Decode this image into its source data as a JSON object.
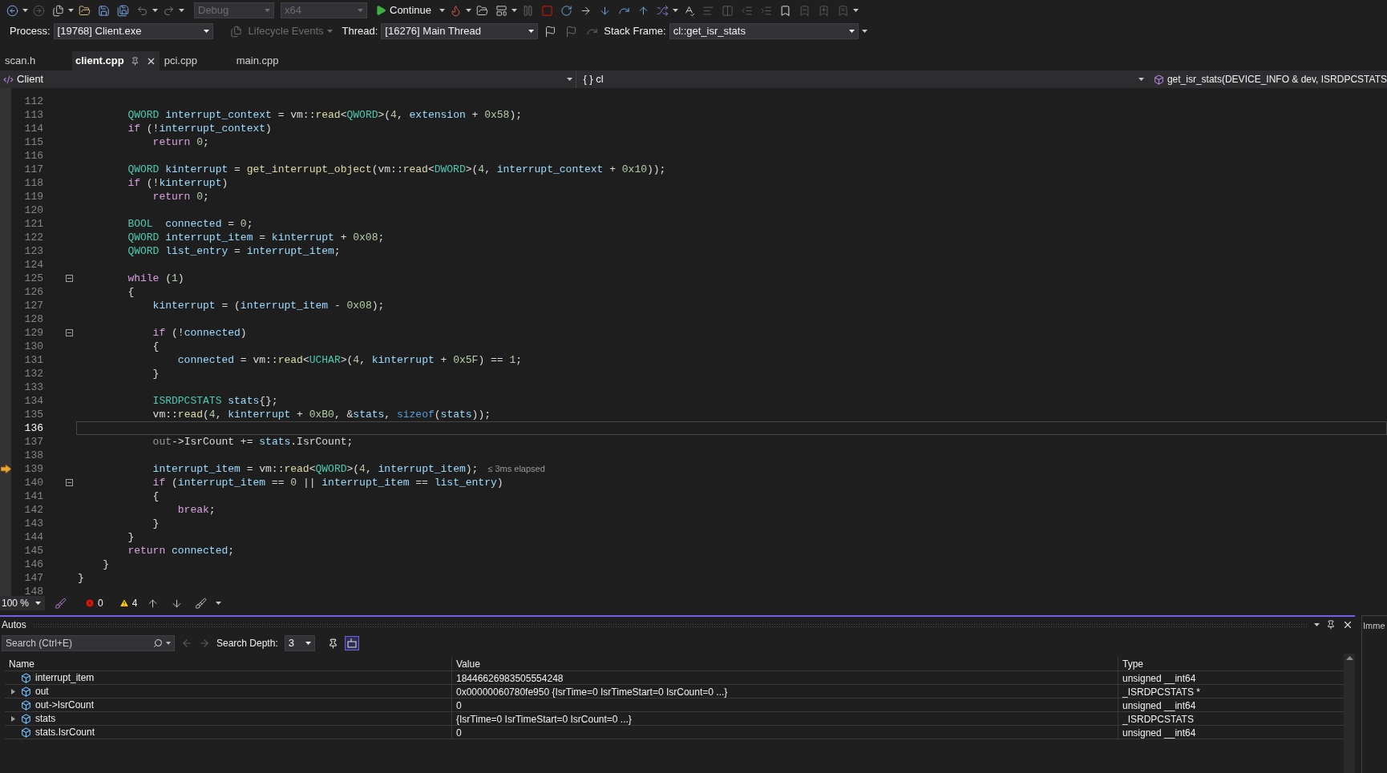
{
  "toolbar": {
    "config": {
      "label": "Debug",
      "disabled": true
    },
    "platform": {
      "label": "x64",
      "disabled": true
    },
    "continue": "Continue",
    "process_label": "Process:",
    "process": "[19768] Client.exe",
    "lifecycle": {
      "label": "Lifecycle Events",
      "disabled": true
    },
    "thread_label": "Thread:",
    "thread": "[16276] Main Thread",
    "stack_label": "Stack Frame:",
    "stack": "cl::get_isr_stats"
  },
  "tabs": [
    {
      "label": "scan.h",
      "selected": false
    },
    {
      "label": "client.cpp",
      "selected": true
    },
    {
      "label": "pci.cpp",
      "selected": false
    },
    {
      "label": "main.cpp",
      "selected": false
    }
  ],
  "navbar": {
    "project": "Client",
    "scope": "{ } cl",
    "member": "get_isr_stats(DEVICE_INFO & dev, ISRDPCSTATS"
  },
  "code": [
    {
      "num": "112",
      "fold": false,
      "current": false,
      "exec": false
    },
    {
      "num": "113",
      "fold": false,
      "current": false,
      "exec": false,
      "tokens": [
        {
          "kind": "type",
          "text": "        QWORD "
        },
        {
          "kind": "var",
          "text": "interrupt_context"
        },
        {
          "kind": "op",
          "text": " = vm::"
        },
        {
          "kind": "fn",
          "text": "read"
        },
        {
          "kind": "op",
          "text": "<"
        },
        {
          "kind": "type",
          "text": "QWORD"
        },
        {
          "kind": "op",
          "text": ">("
        },
        {
          "kind": "num",
          "text": "4"
        },
        {
          "kind": "op",
          "text": ", "
        },
        {
          "kind": "var",
          "text": "extension"
        },
        {
          "kind": "op",
          "text": " + "
        },
        {
          "kind": "num",
          "text": "0x58"
        },
        {
          "kind": "op",
          "text": ");"
        }
      ]
    },
    {
      "num": "114",
      "fold": false,
      "current": false,
      "exec": false,
      "tokens": [
        {
          "kind": "kw",
          "text": "        if"
        },
        {
          "kind": "op",
          "text": " (!"
        },
        {
          "kind": "var",
          "text": "interrupt_context"
        },
        {
          "kind": "op",
          "text": ")"
        }
      ]
    },
    {
      "num": "115",
      "fold": false,
      "current": false,
      "exec": false,
      "tokens": [
        {
          "kind": "kw",
          "text": "            return "
        },
        {
          "kind": "num",
          "text": "0"
        },
        {
          "kind": "op",
          "text": ";"
        }
      ]
    },
    {
      "num": "116",
      "fold": false,
      "current": false,
      "exec": false
    },
    {
      "num": "117",
      "fold": false,
      "current": false,
      "exec": false,
      "tokens": [
        {
          "kind": "type",
          "text": "        QWORD "
        },
        {
          "kind": "var",
          "text": "kinterrupt"
        },
        {
          "kind": "op",
          "text": " = "
        },
        {
          "kind": "fn",
          "text": "get_interrupt_object"
        },
        {
          "kind": "op",
          "text": "(vm::"
        },
        {
          "kind": "fn",
          "text": "read"
        },
        {
          "kind": "op",
          "text": "<"
        },
        {
          "kind": "type",
          "text": "DWORD"
        },
        {
          "kind": "op",
          "text": ">("
        },
        {
          "kind": "num",
          "text": "4"
        },
        {
          "kind": "op",
          "text": ", "
        },
        {
          "kind": "var",
          "text": "interrupt_context"
        },
        {
          "kind": "op",
          "text": " + "
        },
        {
          "kind": "num",
          "text": "0x10"
        },
        {
          "kind": "op",
          "text": "));"
        }
      ]
    },
    {
      "num": "118",
      "fold": false,
      "current": false,
      "exec": false,
      "tokens": [
        {
          "kind": "kw",
          "text": "        if"
        },
        {
          "kind": "op",
          "text": " (!"
        },
        {
          "kind": "var",
          "text": "kinterrupt"
        },
        {
          "kind": "op",
          "text": ")"
        }
      ]
    },
    {
      "num": "119",
      "fold": false,
      "current": false,
      "exec": false,
      "tokens": [
        {
          "kind": "kw",
          "text": "            return "
        },
        {
          "kind": "num",
          "text": "0"
        },
        {
          "kind": "op",
          "text": ";"
        }
      ]
    },
    {
      "num": "120",
      "fold": false,
      "current": false,
      "exec": false
    },
    {
      "num": "121",
      "fold": false,
      "current": false,
      "exec": false,
      "tokens": [
        {
          "kind": "type",
          "text": "        BOOL  "
        },
        {
          "kind": "var",
          "text": "connected"
        },
        {
          "kind": "op",
          "text": " = "
        },
        {
          "kind": "num",
          "text": "0"
        },
        {
          "kind": "op",
          "text": ";"
        }
      ]
    },
    {
      "num": "122",
      "fold": false,
      "current": false,
      "exec": false,
      "tokens": [
        {
          "kind": "type",
          "text": "        QWORD "
        },
        {
          "kind": "var",
          "text": "interrupt_item"
        },
        {
          "kind": "op",
          "text": " = "
        },
        {
          "kind": "var",
          "text": "kinterrupt"
        },
        {
          "kind": "op",
          "text": " + "
        },
        {
          "kind": "num",
          "text": "0x08"
        },
        {
          "kind": "op",
          "text": ";"
        }
      ]
    },
    {
      "num": "123",
      "fold": false,
      "current": false,
      "exec": false,
      "tokens": [
        {
          "kind": "type",
          "text": "        QWORD "
        },
        {
          "kind": "var",
          "text": "list_entry"
        },
        {
          "kind": "op",
          "text": " = "
        },
        {
          "kind": "var",
          "text": "interrupt_item"
        },
        {
          "kind": "op",
          "text": ";"
        }
      ]
    },
    {
      "num": "124",
      "fold": false,
      "current": false,
      "exec": false
    },
    {
      "num": "125",
      "fold": true,
      "current": false,
      "exec": false,
      "tokens": [
        {
          "kind": "kw",
          "text": "        while"
        },
        {
          "kind": "op",
          "text": " ("
        },
        {
          "kind": "num",
          "text": "1"
        },
        {
          "kind": "op",
          "text": ")"
        }
      ]
    },
    {
      "num": "126",
      "fold": false,
      "current": false,
      "exec": false,
      "tokens": [
        {
          "kind": "op",
          "text": "        {"
        }
      ]
    },
    {
      "num": "127",
      "fold": false,
      "current": false,
      "exec": false,
      "tokens": [
        {
          "kind": "var",
          "text": "            kinterrupt"
        },
        {
          "kind": "op",
          "text": " = ("
        },
        {
          "kind": "var",
          "text": "interrupt_item"
        },
        {
          "kind": "op",
          "text": " - "
        },
        {
          "kind": "num",
          "text": "0x08"
        },
        {
          "kind": "op",
          "text": ");"
        }
      ]
    },
    {
      "num": "128",
      "fold": false,
      "current": false,
      "exec": false
    },
    {
      "num": "129",
      "fold": true,
      "current": false,
      "exec": false,
      "tokens": [
        {
          "kind": "kw",
          "text": "            if"
        },
        {
          "kind": "op",
          "text": " (!"
        },
        {
          "kind": "var",
          "text": "connected"
        },
        {
          "kind": "op",
          "text": ")"
        }
      ]
    },
    {
      "num": "130",
      "fold": false,
      "current": false,
      "exec": false,
      "tokens": [
        {
          "kind": "op",
          "text": "            {"
        }
      ]
    },
    {
      "num": "131",
      "fold": false,
      "current": false,
      "exec": false,
      "tokens": [
        {
          "kind": "var",
          "text": "                connected"
        },
        {
          "kind": "op",
          "text": " = vm::"
        },
        {
          "kind": "fn",
          "text": "read"
        },
        {
          "kind": "op",
          "text": "<"
        },
        {
          "kind": "type",
          "text": "UCHAR"
        },
        {
          "kind": "op",
          "text": ">("
        },
        {
          "kind": "num",
          "text": "4"
        },
        {
          "kind": "op",
          "text": ", "
        },
        {
          "kind": "var",
          "text": "kinterrupt"
        },
        {
          "kind": "op",
          "text": " + "
        },
        {
          "kind": "num",
          "text": "0x5F"
        },
        {
          "kind": "op",
          "text": ") == "
        },
        {
          "kind": "num",
          "text": "1"
        },
        {
          "kind": "op",
          "text": ";"
        }
      ]
    },
    {
      "num": "132",
      "fold": false,
      "current": false,
      "exec": false,
      "tokens": [
        {
          "kind": "op",
          "text": "            }"
        }
      ]
    },
    {
      "num": "133",
      "fold": false,
      "current": false,
      "exec": false
    },
    {
      "num": "134",
      "fold": false,
      "current": false,
      "exec": false,
      "tokens": [
        {
          "kind": "type",
          "text": "            ISRDPCSTATS "
        },
        {
          "kind": "var",
          "text": "stats"
        },
        {
          "kind": "op",
          "text": "{};"
        }
      ]
    },
    {
      "num": "135",
      "fold": false,
      "current": false,
      "exec": false,
      "tokens": [
        {
          "kind": "op",
          "text": "            vm::"
        },
        {
          "kind": "fn",
          "text": "read"
        },
        {
          "kind": "op",
          "text": "("
        },
        {
          "kind": "num",
          "text": "4"
        },
        {
          "kind": "op",
          "text": ", "
        },
        {
          "kind": "var",
          "text": "kinterrupt"
        },
        {
          "kind": "op",
          "text": " + "
        },
        {
          "kind": "num",
          "text": "0xB0"
        },
        {
          "kind": "op",
          "text": ", &"
        },
        {
          "kind": "var",
          "text": "stats"
        },
        {
          "kind": "op",
          "text": ", "
        },
        {
          "kind": "kw2",
          "text": "sizeof"
        },
        {
          "kind": "op",
          "text": "("
        },
        {
          "kind": "var",
          "text": "stats"
        },
        {
          "kind": "op",
          "text": "));"
        }
      ]
    },
    {
      "num": "136",
      "fold": false,
      "current": true,
      "exec": false
    },
    {
      "num": "137",
      "fold": false,
      "current": false,
      "exec": false,
      "tokens": [
        {
          "kind": "param",
          "text": "            out"
        },
        {
          "kind": "op",
          "text": "->"
        },
        {
          "kind": "member",
          "text": "IsrCount"
        },
        {
          "kind": "op",
          "text": " += "
        },
        {
          "kind": "var",
          "text": "stats"
        },
        {
          "kind": "op",
          "text": "."
        },
        {
          "kind": "member",
          "text": "IsrCount"
        },
        {
          "kind": "op",
          "text": ";"
        }
      ]
    },
    {
      "num": "138",
      "fold": false,
      "current": false,
      "exec": false
    },
    {
      "num": "139",
      "fold": false,
      "current": false,
      "exec": true,
      "hint": "≤ 3ms elapsed",
      "tokens": [
        {
          "kind": "var",
          "text": "            interrupt_item"
        },
        {
          "kind": "op",
          "text": " = vm::"
        },
        {
          "kind": "fn",
          "text": "read"
        },
        {
          "kind": "op",
          "text": "<"
        },
        {
          "kind": "type",
          "text": "QWORD"
        },
        {
          "kind": "op",
          "text": ">("
        },
        {
          "kind": "num",
          "text": "4"
        },
        {
          "kind": "op",
          "text": ", "
        },
        {
          "kind": "var",
          "text": "interrupt_item"
        },
        {
          "kind": "op",
          "text": ");"
        }
      ]
    },
    {
      "num": "140",
      "fold": true,
      "current": false,
      "exec": false,
      "tokens": [
        {
          "kind": "kw",
          "text": "            if"
        },
        {
          "kind": "op",
          "text": " ("
        },
        {
          "kind": "var",
          "text": "interrupt_item"
        },
        {
          "kind": "op",
          "text": " == "
        },
        {
          "kind": "num",
          "text": "0"
        },
        {
          "kind": "op",
          "text": " || "
        },
        {
          "kind": "var",
          "text": "interrupt_item"
        },
        {
          "kind": "op",
          "text": " == "
        },
        {
          "kind": "var",
          "text": "list_entry"
        },
        {
          "kind": "op",
          "text": ")"
        }
      ]
    },
    {
      "num": "141",
      "fold": false,
      "current": false,
      "exec": false,
      "tokens": [
        {
          "kind": "op",
          "text": "            {"
        }
      ]
    },
    {
      "num": "142",
      "fold": false,
      "current": false,
      "exec": false,
      "tokens": [
        {
          "kind": "kw",
          "text": "                break"
        },
        {
          "kind": "op",
          "text": ";"
        }
      ]
    },
    {
      "num": "143",
      "fold": false,
      "current": false,
      "exec": false,
      "tokens": [
        {
          "kind": "op",
          "text": "            }"
        }
      ]
    },
    {
      "num": "144",
      "fold": false,
      "current": false,
      "exec": false,
      "tokens": [
        {
          "kind": "op",
          "text": "        }"
        }
      ]
    },
    {
      "num": "145",
      "fold": false,
      "current": false,
      "exec": false,
      "tokens": [
        {
          "kind": "kw",
          "text": "        return "
        },
        {
          "kind": "var",
          "text": "connected"
        },
        {
          "kind": "op",
          "text": ";"
        }
      ]
    },
    {
      "num": "146",
      "fold": false,
      "current": false,
      "exec": false,
      "tokens": [
        {
          "kind": "op",
          "text": "    }"
        }
      ]
    },
    {
      "num": "147",
      "fold": false,
      "current": false,
      "exec": false,
      "tokens": [
        {
          "kind": "op",
          "text": "}"
        }
      ]
    },
    {
      "num": "148",
      "fold": false,
      "current": false,
      "exec": false
    }
  ],
  "editor_status": {
    "zoom": "100 %",
    "errors": "0",
    "warnings": "4"
  },
  "autos": {
    "title": "Autos",
    "search_placeholder": "Search (Ctrl+E)",
    "depth_label": "Search Depth:",
    "depth": "3",
    "columns": [
      "Name",
      "Value",
      "Type"
    ],
    "rows": [
      {
        "name": "interrupt_item",
        "value": "18446626983505554248",
        "type": "unsigned __int64",
        "expandable": false
      },
      {
        "name": "out",
        "value": "0x00000060780fe950 {IsrTime=0 IsrTimeStart=0 IsrCount=0 ...}",
        "type": "_ISRDPCSTATS *",
        "expandable": true
      },
      {
        "name": "out->IsrCount",
        "value": "0",
        "type": "unsigned __int64",
        "expandable": false
      },
      {
        "name": "stats",
        "value": "{IsrTime=0 IsrTimeStart=0 IsrCount=0 ...}",
        "type": "_ISRDPCSTATS",
        "expandable": true
      },
      {
        "name": "stats.IsrCount",
        "value": "0",
        "type": "unsigned __int64",
        "expandable": false
      }
    ]
  },
  "side_tab": "Imme"
}
